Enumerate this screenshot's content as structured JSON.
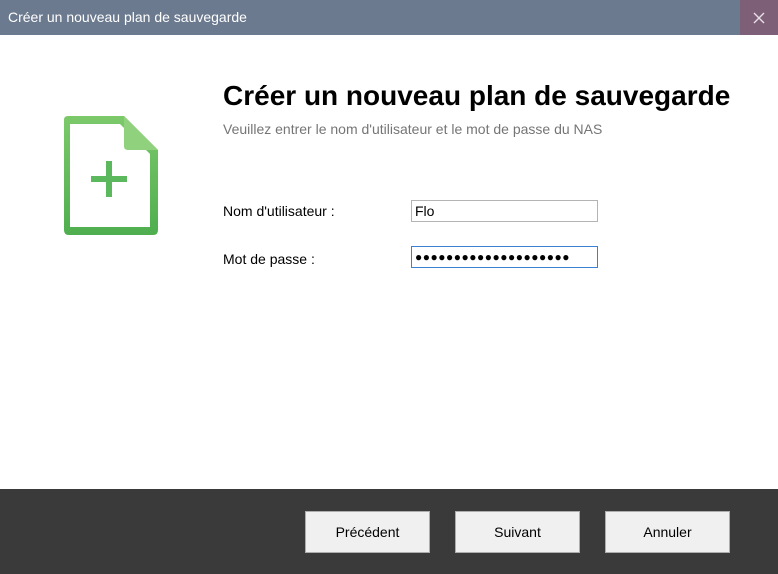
{
  "window": {
    "title": "Créer un nouveau plan de sauvegarde",
    "close_icon": "close-icon"
  },
  "main": {
    "icon": "document-add-icon",
    "heading": "Créer un nouveau plan de sauvegarde",
    "subheading": "Veuillez entrer le nom d'utilisateur et le mot de passe du NAS",
    "username_label": "Nom d'utilisateur :",
    "username_value": "Flo",
    "password_label": "Mot de passe :",
    "password_value": "●●●●●●●●●●●●●●●●●●●●"
  },
  "footer": {
    "previous_label": "Précédent",
    "next_label": "Suivant",
    "cancel_label": "Annuler"
  },
  "colors": {
    "titlebar": "#6b7a8f",
    "close_button": "#7d5f78",
    "icon_green": "#5cb85c",
    "footer": "#3a3a3a"
  }
}
